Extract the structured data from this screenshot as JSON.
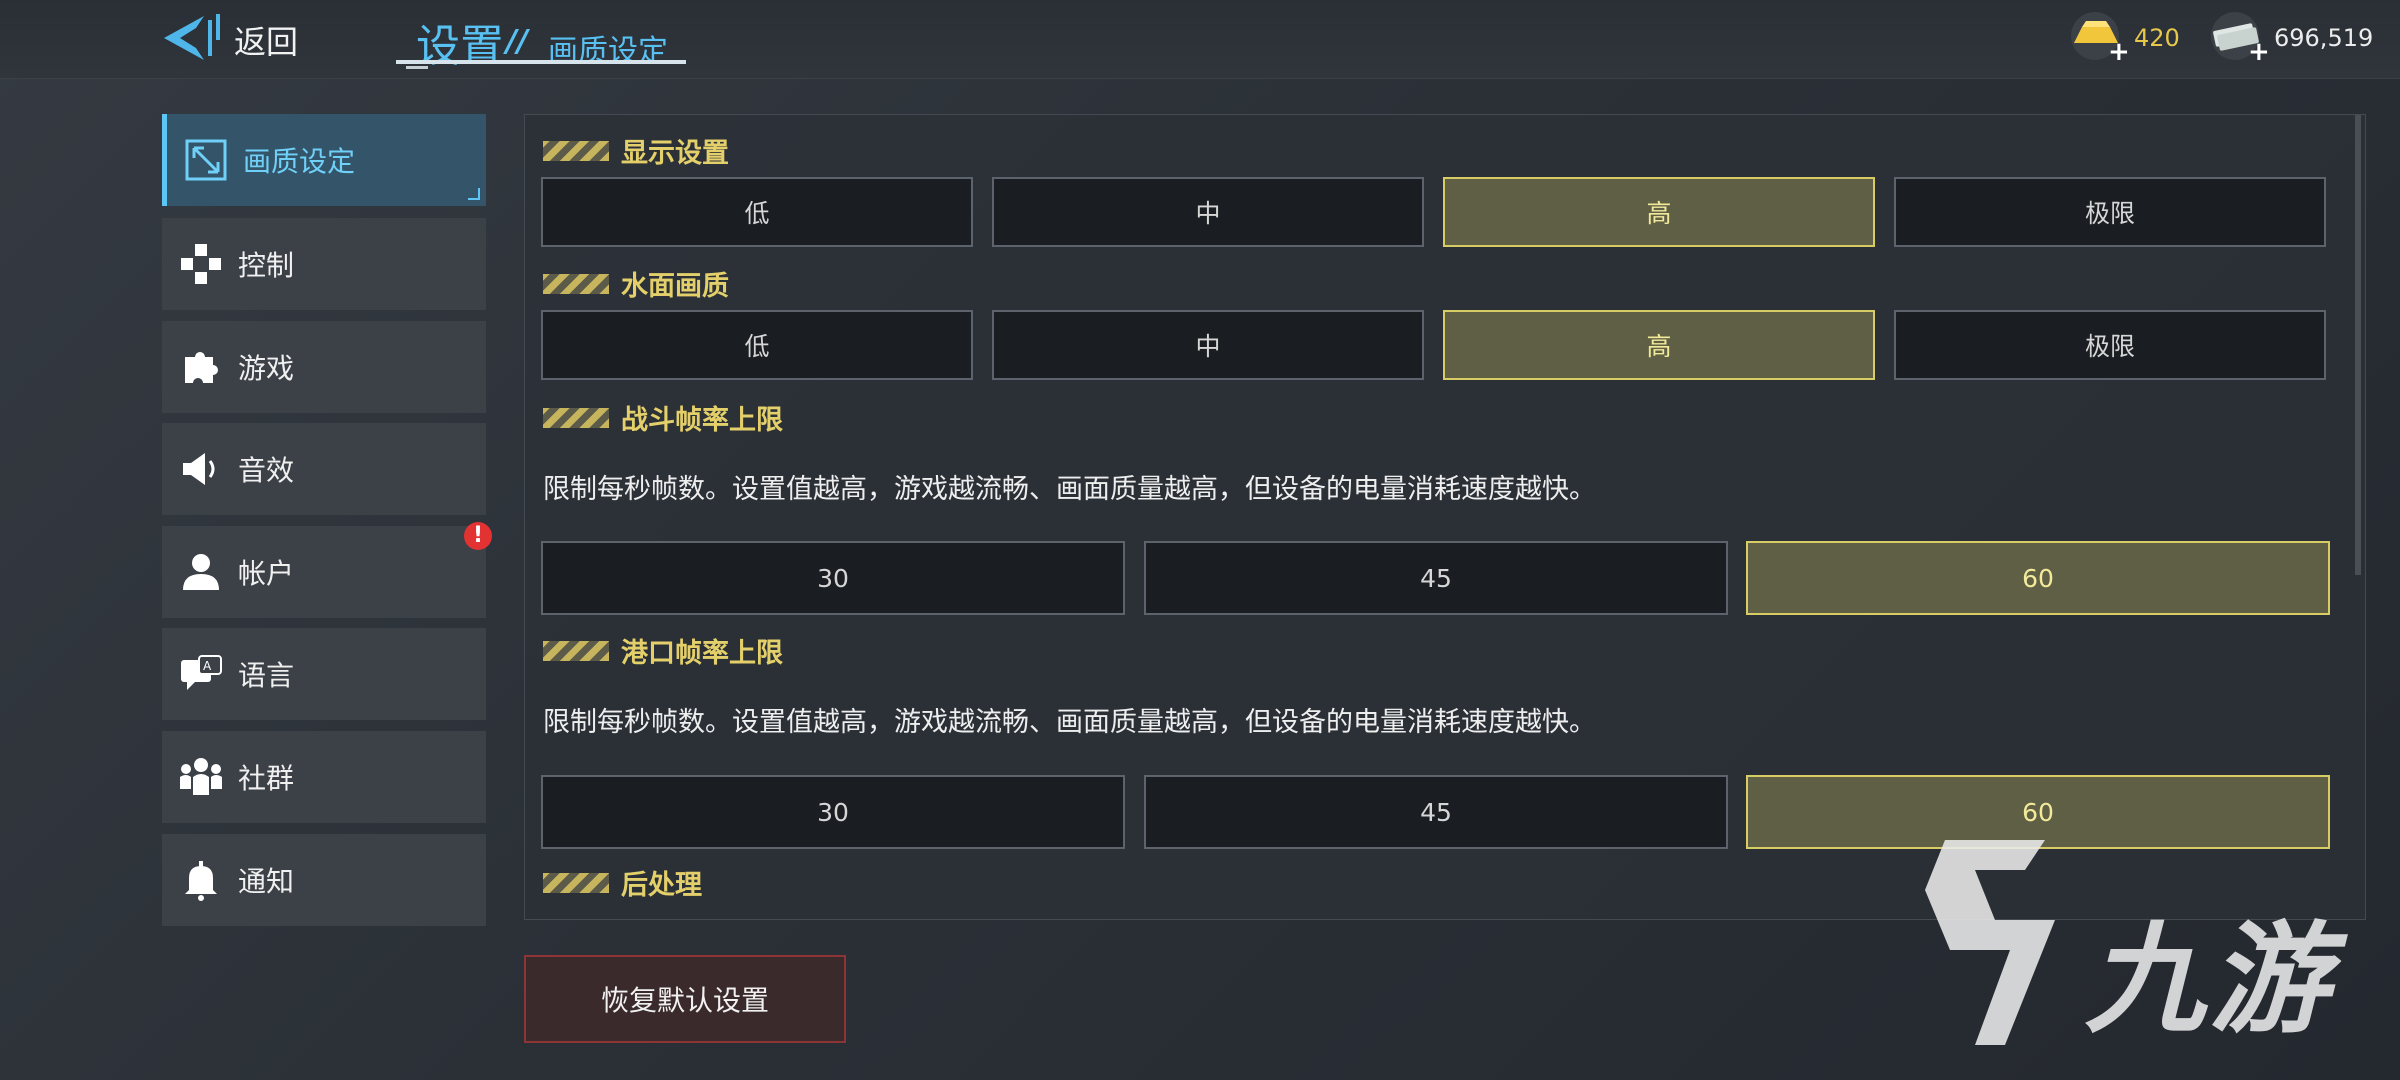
{
  "header": {
    "back_label": "返回",
    "title": "设置",
    "separator": "//",
    "subtitle": "画质设定"
  },
  "currency": {
    "gold": "420",
    "silver": "696,519"
  },
  "sidebar": {
    "items": [
      {
        "label": "画质设定",
        "icon": "resize-icon",
        "active": true
      },
      {
        "label": "控制",
        "icon": "gamepad-icon"
      },
      {
        "label": "游戏",
        "icon": "puzzle-icon"
      },
      {
        "label": "音效",
        "icon": "speaker-icon"
      },
      {
        "label": "帐户",
        "icon": "user-icon",
        "alert": "!"
      },
      {
        "label": "语言",
        "icon": "translate-icon"
      },
      {
        "label": "社群",
        "icon": "community-icon"
      },
      {
        "label": "通知",
        "icon": "bell-icon"
      }
    ]
  },
  "sections": {
    "display": {
      "title": "显示设置",
      "options": [
        "低",
        "中",
        "高",
        "极限"
      ],
      "selected": "高"
    },
    "water": {
      "title": "水面画质",
      "options": [
        "低",
        "中",
        "高",
        "极限"
      ],
      "selected": "高"
    },
    "battle_fps": {
      "title": "战斗帧率上限",
      "desc": "限制每秒帧数。设置值越高，游戏越流畅、画面质量越高，但设备的电量消耗速度越快。",
      "options": [
        "30",
        "45",
        "60"
      ],
      "selected": "60"
    },
    "port_fps": {
      "title": "港口帧率上限",
      "desc": "限制每秒帧数。设置值越高，游戏越流畅、画面质量越高，但设备的电量消耗速度越快。",
      "options": [
        "30",
        "45",
        "60"
      ],
      "selected": "60"
    },
    "post": {
      "title": "后处理"
    }
  },
  "reset_label": "恢复默认设置",
  "watermark": "九游",
  "colors": {
    "accent": "#5ec6f4",
    "selected": "#d8cd64",
    "section_title": "#e4d06a"
  }
}
